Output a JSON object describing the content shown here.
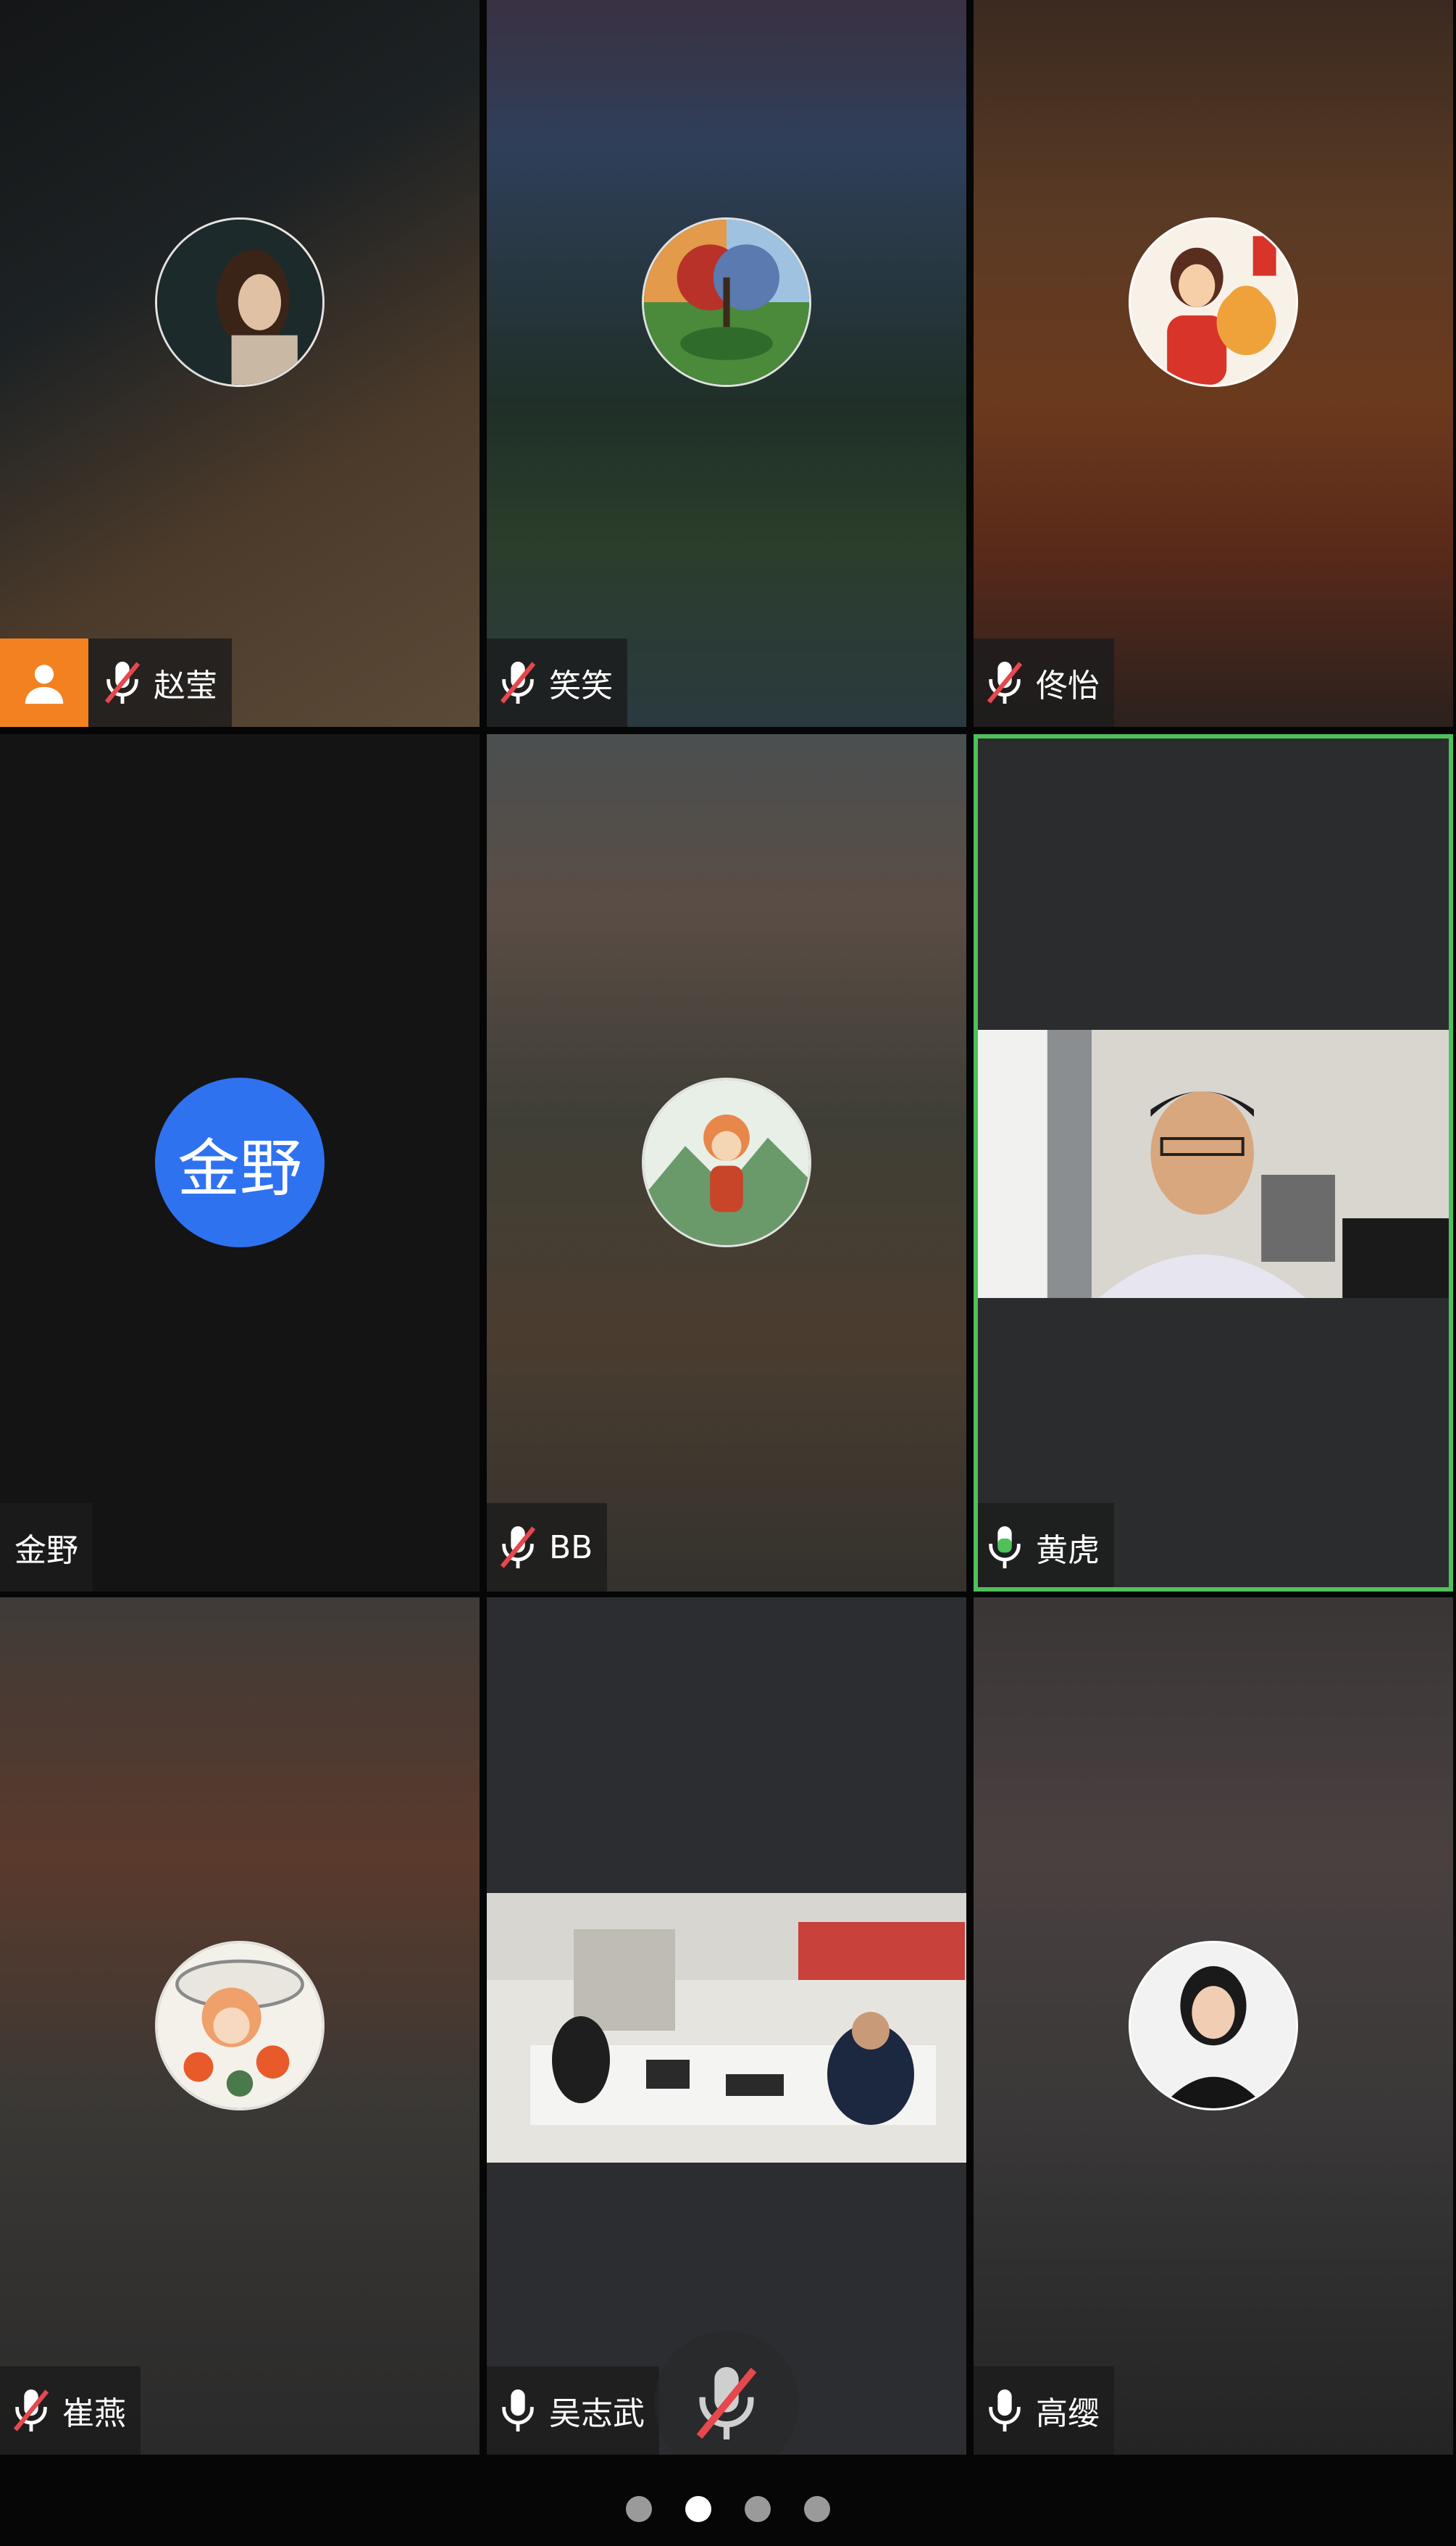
{
  "participants": [
    {
      "name": "赵莹",
      "muted": true,
      "host": true
    },
    {
      "name": "笑笑",
      "muted": true
    },
    {
      "name": "佟怡",
      "muted": true
    },
    {
      "name": "金野",
      "avatar_text": "金野"
    },
    {
      "name": "BB",
      "muted": true
    },
    {
      "name": "黄虎",
      "muted": false,
      "active_speaker": true
    },
    {
      "name": "崔燕",
      "muted": true
    },
    {
      "name": "吴志武",
      "muted": false
    },
    {
      "name": "高缨",
      "muted": false
    }
  ],
  "colors": {
    "host_badge": "#f3811f",
    "active_border": "#4ec15a",
    "avatar_blue": "#2f72f0",
    "muted_slash": "#e5484d",
    "speaking_mic": "#4ec15a"
  },
  "pager": {
    "total": 4,
    "current": 2
  }
}
